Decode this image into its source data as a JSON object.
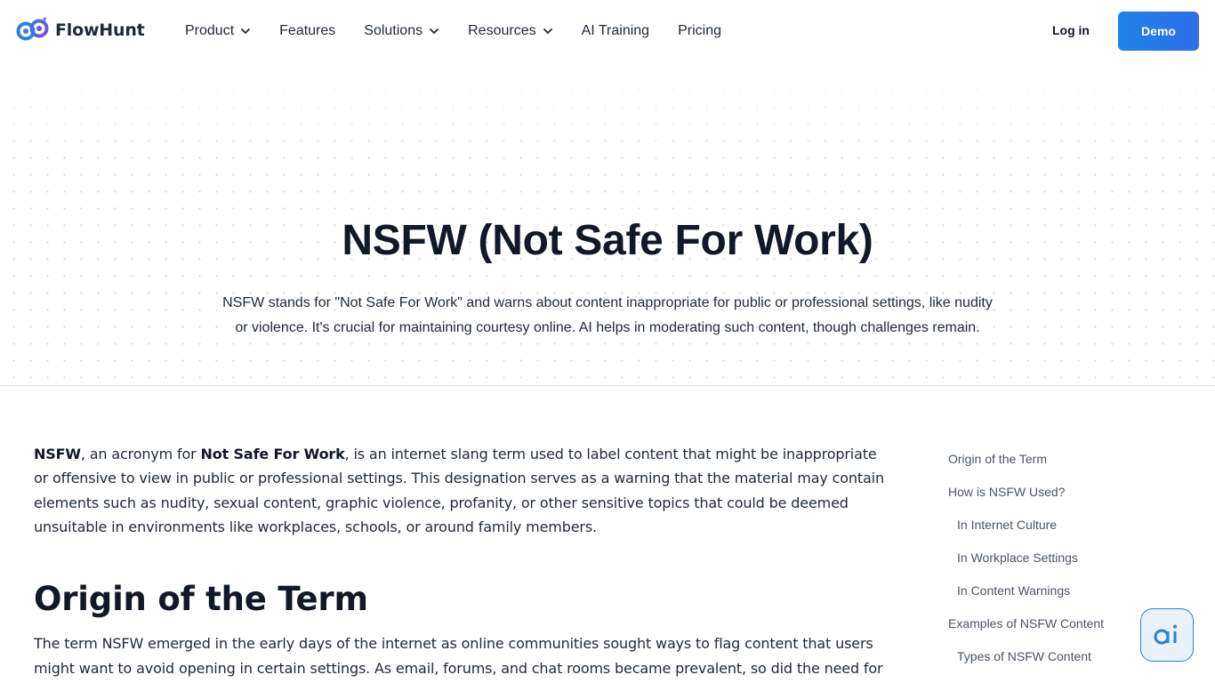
{
  "brand": {
    "name": "FlowHunt"
  },
  "nav": {
    "items": [
      {
        "label": "Product",
        "has_dropdown": true
      },
      {
        "label": "Features",
        "has_dropdown": false
      },
      {
        "label": "Solutions",
        "has_dropdown": true
      },
      {
        "label": "Resources",
        "has_dropdown": true
      },
      {
        "label": "AI Training",
        "has_dropdown": false
      },
      {
        "label": "Pricing",
        "has_dropdown": false
      }
    ],
    "login_label": "Log in",
    "demo_label": "Demo"
  },
  "hero": {
    "title": "NSFW (Not Safe For Work)",
    "description": "NSFW stands for \"Not Safe For Work\" and warns about content inappropriate for public or professional settings, like nudity or violence. It's crucial for maintaining courtesy online. AI helps in moderating such content, though challenges remain."
  },
  "article": {
    "intro_term": "NSFW",
    "intro_mid": ", an acronym for ",
    "intro_expansion": "Not Safe For Work",
    "intro_rest": ", is an internet slang term used to label content that might be inappropriate or offensive to view in public or professional settings. This designation serves as a warning that the material may contain elements such as nudity, sexual content, graphic violence, profanity, or other sensitive topics that could be deemed unsuitable in environments like workplaces, schools, or around family members.",
    "section_heading": "Origin of the Term",
    "section_paragraph": "The term NSFW emerged in the early days of the internet as online communities sought ways to flag content that users might want to avoid opening in certain settings. As email, forums, and chat rooms became prevalent, so did the need for a"
  },
  "toc": {
    "items": [
      {
        "label": "Origin of the Term",
        "level": 1
      },
      {
        "label": "How is NSFW Used?",
        "level": 1
      },
      {
        "label": "In Internet Culture",
        "level": 2
      },
      {
        "label": "In Workplace Settings",
        "level": 2
      },
      {
        "label": "In Content Warnings",
        "level": 2
      },
      {
        "label": "Examples of NSFW Content",
        "level": 1
      },
      {
        "label": "Types of NSFW Content",
        "level": 2
      }
    ]
  },
  "chat_widget": {
    "icon": "ai-chat-icon"
  },
  "colors": {
    "accent": "#2a7fd6",
    "demo_button": "#1d82e6",
    "text": "#111827"
  }
}
